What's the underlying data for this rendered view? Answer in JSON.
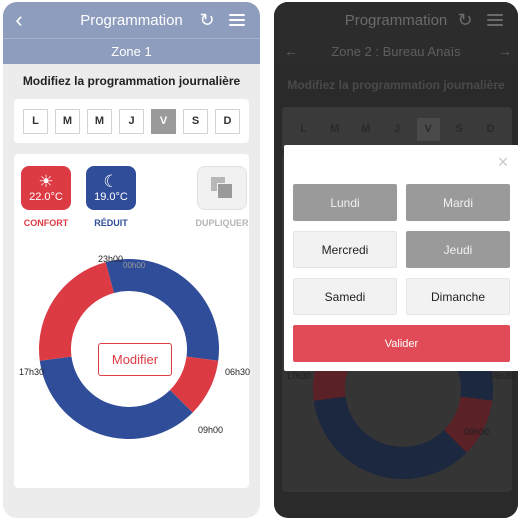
{
  "left": {
    "title": "Programmation",
    "zone": "Zone 1",
    "heading": "Modifiez la programmation journalière",
    "days": [
      "L",
      "M",
      "M",
      "J",
      "V",
      "S",
      "D"
    ],
    "selected_day_index": 4,
    "modes": {
      "confort": {
        "label": "CONFORT",
        "temp": "22.0°C",
        "icon": "sun-icon"
      },
      "reduit": {
        "label": "RÉDUIT",
        "temp": "19.0°C",
        "icon": "moon-icon"
      },
      "dupliquer": {
        "label": "DUPLIQUER",
        "icon": "copy-icon"
      }
    },
    "schedule_labels": {
      "t2300": "23h00",
      "t0000": "00h00",
      "t0630": "06h30",
      "t0900": "09h00",
      "t1730": "17h30"
    },
    "modify_label": "Modifier"
  },
  "right": {
    "title": "Programmation",
    "zone": "Zone 2 : Bureau Anaïs",
    "heading": "Modifiez la programmation journalière",
    "days": [
      "L",
      "M",
      "M",
      "J",
      "V",
      "S",
      "D"
    ],
    "selected_day_index": 4,
    "bg_labels": {
      "t1730": "17h30",
      "t0630": "06h30",
      "t0900": "09h00"
    },
    "modal": {
      "close": "×",
      "days": [
        {
          "label": "Lundi",
          "selected": true
        },
        {
          "label": "Mardi",
          "selected": true
        },
        {
          "label": "Mercredi",
          "selected": false
        },
        {
          "label": "Jeudi",
          "selected": true
        },
        {
          "label": "Samedi",
          "selected": false
        },
        {
          "label": "Dimanche",
          "selected": false
        }
      ],
      "validate": "Valider"
    }
  },
  "icons": {
    "back": "back-arrow-icon",
    "refresh": "refresh-icon",
    "menu": "hamburger-menu-icon"
  },
  "colors": {
    "confort": "#dd3b44",
    "reduit": "#2f4d98",
    "header": "#8e9dbd",
    "accent": "#e04b57"
  },
  "schedule": [
    {
      "from": "00:00",
      "to": "06:30",
      "mode": "reduit"
    },
    {
      "from": "06:30",
      "to": "09:00",
      "mode": "confort"
    },
    {
      "from": "09:00",
      "to": "17:30",
      "mode": "reduit"
    },
    {
      "from": "17:30",
      "to": "23:00",
      "mode": "confort"
    },
    {
      "from": "23:00",
      "to": "24:00",
      "mode": "reduit"
    }
  ]
}
